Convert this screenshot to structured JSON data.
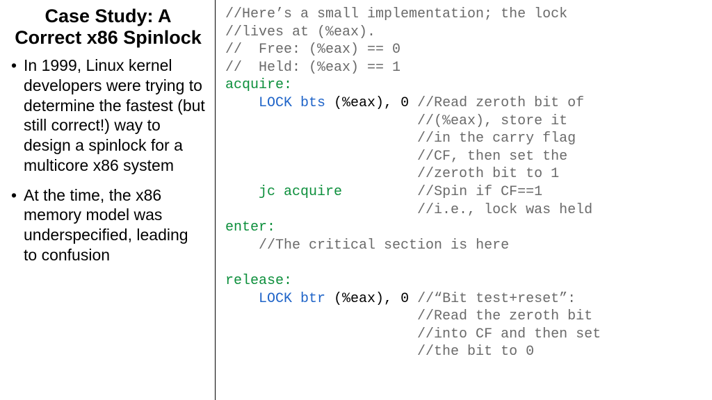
{
  "left": {
    "title": "Case Study: A Correct x86 Spinlock",
    "bullets": [
      "In 1999, Linux kernel developers were trying to determine the fastest (but still correct!) way to design a spinlock for a multicore x86 system",
      "At the time, the x86 memory model was underspecified, leading to confusion"
    ]
  },
  "code": {
    "c1": "//Here’s a small implementation; the lock",
    "c2": "//lives at (%eax).",
    "c3": "//  Free: (%eax) == 0",
    "c4": "//  Held: (%eax) == 1",
    "lbl_acq": "acquire:",
    "indent": "    ",
    "kw_lock": "LOCK",
    "ins_bts": " bts",
    "arg": " (%eax), 0 ",
    "c5": "//Read zeroth bit of",
    "pad23": "                       ",
    "c6": "//(%eax), store it",
    "c7": "//in the carry flag",
    "c8": "//CF, then set the",
    "c9": "//zeroth bit to 1",
    "jc": "jc acquire",
    "jc_pad": "         ",
    "c10": "//Spin if CF==1",
    "c11": "//i.e., lock was held",
    "lbl_enter": "enter:",
    "c12": "//The critical section is here",
    "lbl_rel": "release:",
    "ins_btr": " btr",
    "c13": "//“Bit test+reset”:",
    "c14": "//Read the zeroth bit",
    "c15": "//into CF and then set",
    "c16": "//the bit to 0"
  }
}
